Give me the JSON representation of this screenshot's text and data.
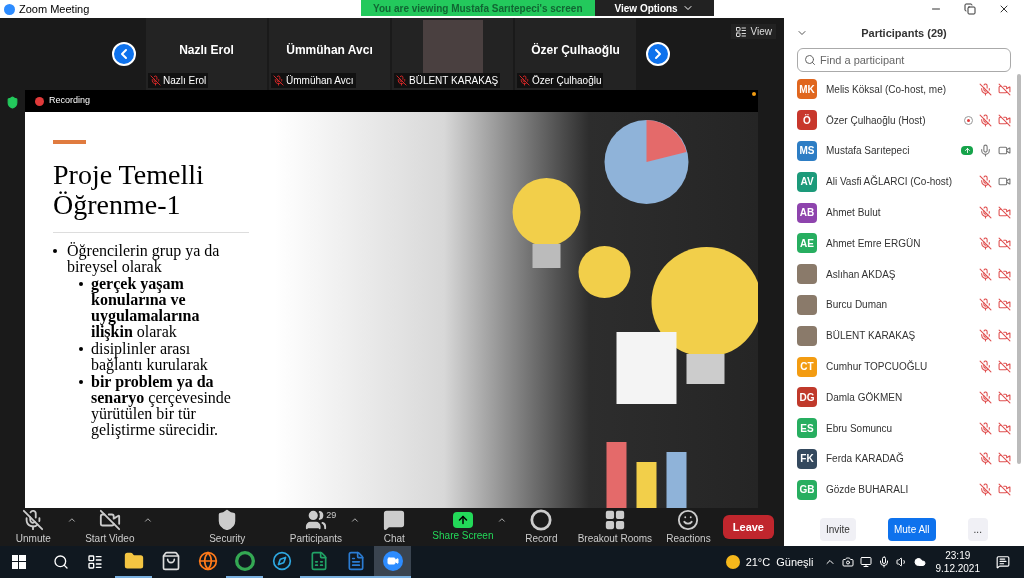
{
  "window": {
    "title": "Zoom Meeting"
  },
  "banner": {
    "text": "You are viewing Mustafa Sarıtepeci's screen",
    "view_options": "View Options"
  },
  "view_button": "View",
  "thumbnails": [
    {
      "name": "Nazlı Erol",
      "label": "Nazlı Erol",
      "muted": true,
      "video": false
    },
    {
      "name": "Ümmühan Avcı",
      "label": "Ümmühan Avcı",
      "muted": true,
      "video": false
    },
    {
      "label": "BÜLENT KARAKAŞ",
      "muted": true,
      "video": true
    },
    {
      "name": "Özer Çulhaoğlu",
      "label": "Özer Çulhaoğlu",
      "muted": true,
      "video": false
    }
  ],
  "recording": "Recording",
  "slide": {
    "title": "Proje Temelli Öğrenme-1",
    "bullets": [
      {
        "text": "Öğrencilerin grup ya da bireysel olarak",
        "children": [
          {
            "text": "**gerçek yaşam konularına ve uygulamalarına ilişkin** olarak"
          },
          {
            "text": "disiplinler arası bağlantı kurularak"
          },
          {
            "text": "**bir problem ya da senaryo** çerçevesinde yürütülen bir tür geliştirme sürecidir."
          }
        ]
      }
    ]
  },
  "toolbar": [
    {
      "kind": "mic",
      "label": "Unmute",
      "off": true
    },
    {
      "kind": "video",
      "label": "Start Video",
      "off": true
    },
    {
      "kind": "security",
      "label": "Security"
    },
    {
      "kind": "participants",
      "label": "Participants",
      "count": "29"
    },
    {
      "kind": "chat",
      "label": "Chat"
    },
    {
      "kind": "share",
      "label": "Share Screen"
    },
    {
      "kind": "record",
      "label": "Record"
    },
    {
      "kind": "breakout",
      "label": "Breakout Rooms"
    },
    {
      "kind": "reactions",
      "label": "Reactions"
    }
  ],
  "leave": "Leave",
  "participants_panel": {
    "title": "Participants (29)",
    "search": {
      "placeholder": "Find a participant"
    },
    "participants": [
      {
        "initials": "MK",
        "color": "#e0661e",
        "name": "Melis Köksal (Co-host, me)",
        "muted": true,
        "video_off": true,
        "recording": false,
        "sharing": false
      },
      {
        "initials": "Ö",
        "color": "#c8372c",
        "name": "Özer Çulhaoğlu (Host)",
        "muted": true,
        "video_off": true,
        "recording": true,
        "sharing": false
      },
      {
        "initials": "MS",
        "color": "#2d7dc4",
        "name": "Mustafa Sarıtepeci",
        "muted": false,
        "video_off": false,
        "recording": false,
        "sharing": true
      },
      {
        "initials": "AV",
        "color": "#1c9a7a",
        "name": "Ali Vasfi AĞLARCI (Co-host)",
        "muted": true,
        "video_off": false,
        "recording": false,
        "sharing": false
      },
      {
        "initials": "AB",
        "color": "#8e44ad",
        "name": "Ahmet Bulut",
        "muted": true,
        "video_off": true,
        "recording": false,
        "sharing": false
      },
      {
        "initials": "AE",
        "color": "#27ae60",
        "name": "Ahmet Emre ERGÜN",
        "muted": true,
        "video_off": true,
        "recording": false,
        "sharing": false
      },
      {
        "photo": true,
        "name": "Aslıhan AKDAŞ",
        "muted": true,
        "video_off": true,
        "recording": false,
        "sharing": false
      },
      {
        "photo": true,
        "name": "Burcu Duman",
        "muted": true,
        "video_off": true,
        "recording": false,
        "sharing": false
      },
      {
        "photo": true,
        "name": "BÜLENT KARAKAŞ",
        "muted": true,
        "video_off": true,
        "recording": false,
        "sharing": false
      },
      {
        "initials": "CT",
        "color": "#f39c12",
        "name": "Cumhur TOPCUOĞLU",
        "muted": true,
        "video_off": true,
        "recording": false,
        "sharing": false
      },
      {
        "initials": "DG",
        "color": "#c0392b",
        "name": "Damla GÖKMEN",
        "muted": true,
        "video_off": true,
        "recording": false,
        "sharing": false
      },
      {
        "initials": "ES",
        "color": "#27ae60",
        "name": "Ebru Somuncu",
        "muted": true,
        "video_off": true,
        "recording": false,
        "sharing": false
      },
      {
        "initials": "FK",
        "color": "#34495e",
        "name": "Ferda KARADAĞ",
        "muted": true,
        "video_off": true,
        "recording": false,
        "sharing": false
      },
      {
        "initials": "GB",
        "color": "#27ae60",
        "name": "Gözde BUHARALI",
        "muted": true,
        "video_off": true,
        "recording": false,
        "sharing": false
      }
    ],
    "buttons": [
      {
        "label": "Invite",
        "primary": false
      },
      {
        "label": "Mute All",
        "primary": true
      },
      {
        "label": "...",
        "primary": false
      }
    ]
  },
  "taskbar": {
    "apps": [
      {
        "kind": "explorer",
        "running": true,
        "selected": false
      },
      {
        "kind": "store",
        "running": false,
        "selected": false
      },
      {
        "kind": "firefox",
        "running": false,
        "selected": false
      },
      {
        "kind": "chrome",
        "running": true,
        "selected": false
      },
      {
        "kind": "edge",
        "running": false,
        "selected": false
      },
      {
        "kind": "excel",
        "running": true,
        "selected": false
      },
      {
        "kind": "word",
        "running": true,
        "selected": false
      },
      {
        "kind": "zoom",
        "running": true,
        "selected": true
      }
    ],
    "temperature": "21°C",
    "weather": "Güneşli",
    "time": "23:19",
    "date": "9.12.2021"
  }
}
